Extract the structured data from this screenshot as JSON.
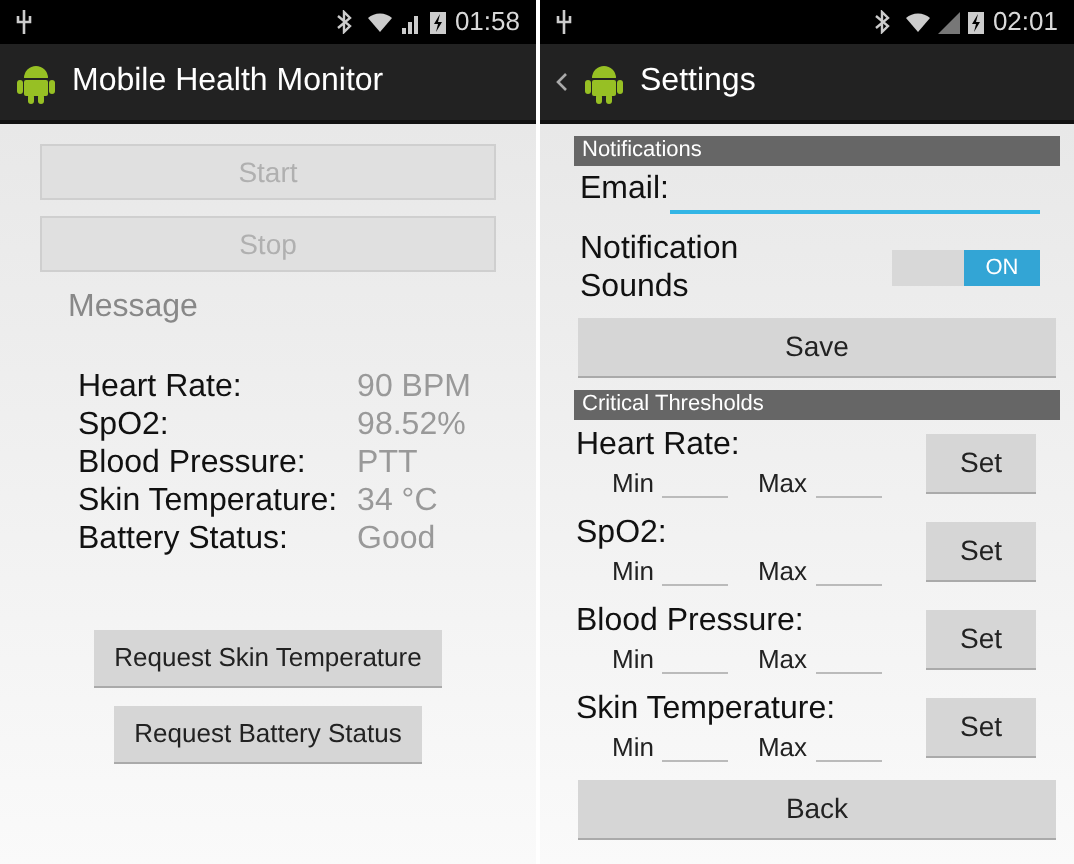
{
  "screens": [
    {
      "status_bar": {
        "time": "01:58"
      },
      "action_bar": {
        "title": "Mobile Health Monitor",
        "up": false
      },
      "buttons": [
        {
          "label": "Start",
          "disabled": true
        },
        {
          "label": "Stop",
          "disabled": true
        }
      ],
      "message": "Message",
      "readings": [
        {
          "label": "Heart Rate:",
          "value": "90 BPM"
        },
        {
          "label": "SpO2:",
          "value": "98.52%"
        },
        {
          "label": "Blood Pressure:",
          "value": "PTT"
        },
        {
          "label": "Skin Temperature:",
          "value": "34 °C"
        },
        {
          "label": "Battery Status:",
          "value": "Good"
        }
      ],
      "request_buttons": [
        "Request Skin Temperature",
        "Request Battery Status"
      ]
    },
    {
      "status_bar": {
        "time": "02:01"
      },
      "action_bar": {
        "title": "Settings",
        "up": true
      },
      "notifications": {
        "header": "Notifications",
        "email_label": "Email:",
        "sound_label": "Notification Sounds",
        "toggle": {
          "label": "ON",
          "on": true
        },
        "save": "Save"
      },
      "thresholds": {
        "header": "Critical Thresholds",
        "items": [
          {
            "label": "Heart Rate:",
            "min_label": "Min",
            "max_label": "Max",
            "set": "Set"
          },
          {
            "label": "SpO2:",
            "min_label": "Min",
            "max_label": "Max",
            "set": "Set"
          },
          {
            "label": "Blood Pressure:",
            "min_label": "Min",
            "max_label": "Max",
            "set": "Set"
          },
          {
            "label": "Skin Temperature:",
            "min_label": "Min",
            "max_label": "Max",
            "set": "Set"
          }
        ]
      },
      "back": "Back"
    }
  ]
}
